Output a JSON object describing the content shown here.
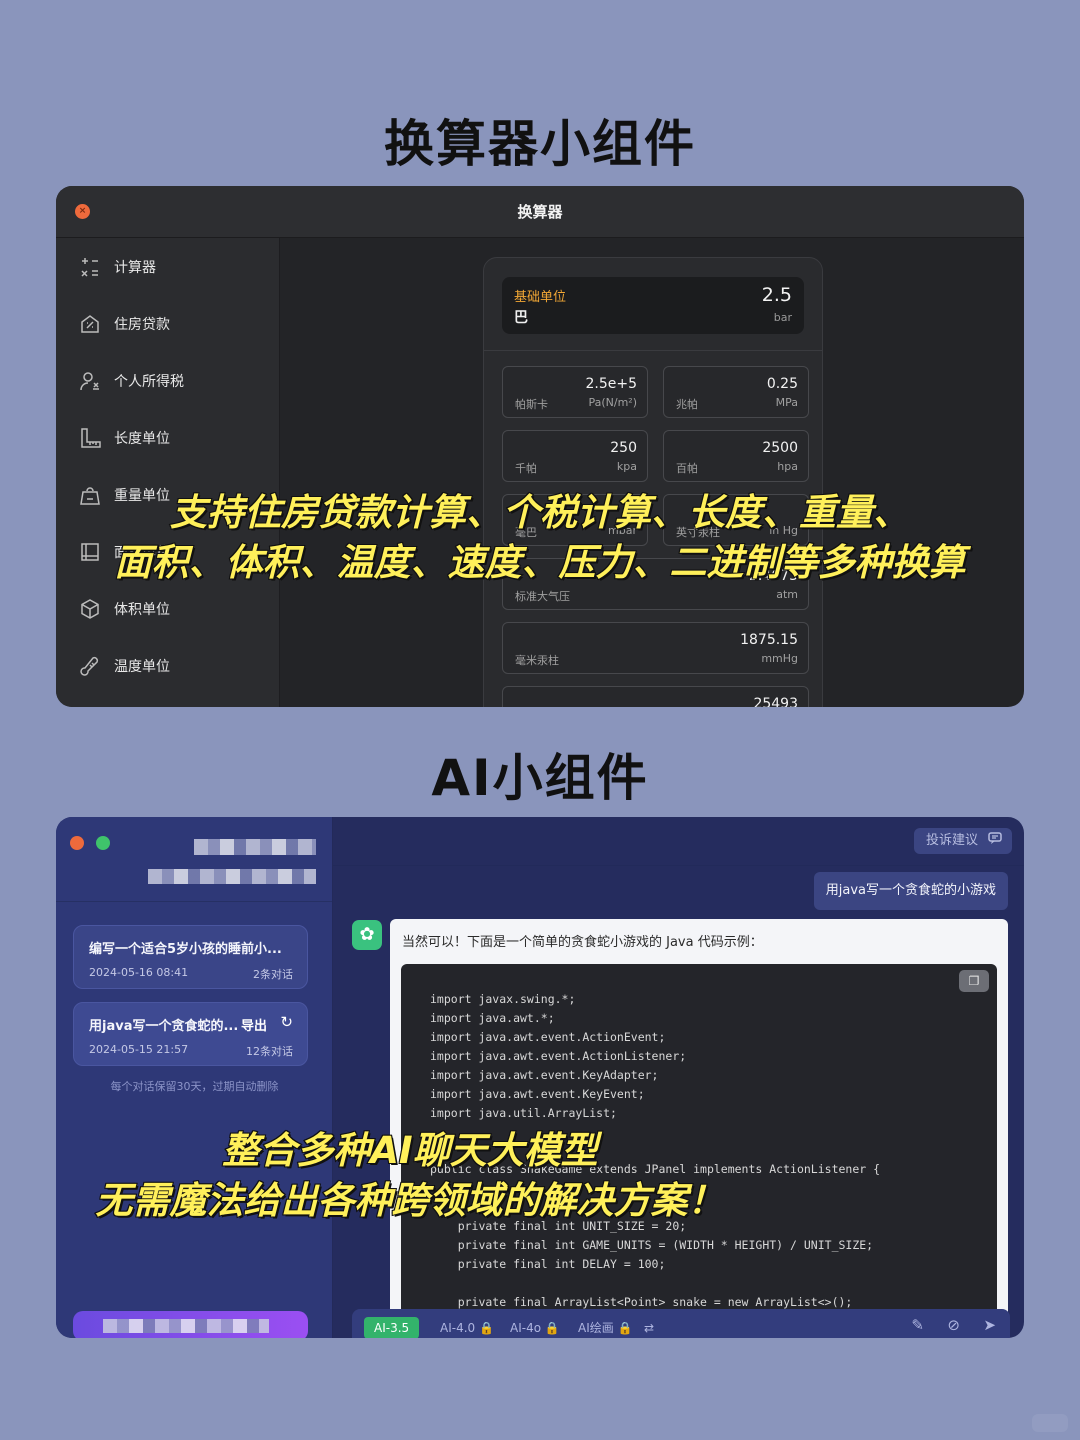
{
  "headings": {
    "top": "换算器小组件",
    "bottom": "AI小组件"
  },
  "converter": {
    "title": "换算器",
    "close_glyph": "×",
    "sidebar": [
      {
        "label": "计算器",
        "icon": "calculator-icon"
      },
      {
        "label": "住房贷款",
        "icon": "house-loan-icon"
      },
      {
        "label": "个人所得税",
        "icon": "person-tax-icon"
      },
      {
        "label": "长度单位",
        "icon": "ruler-icon"
      },
      {
        "label": "重量单位",
        "icon": "weight-icon"
      },
      {
        "label": "面积单位",
        "icon": "area-icon"
      },
      {
        "label": "体积单位",
        "icon": "cube-icon"
      },
      {
        "label": "温度单位",
        "icon": "thermometer-icon"
      }
    ],
    "base": {
      "label": "基础单位",
      "name": "巴",
      "value": "2.5",
      "unit": "bar"
    },
    "units": [
      {
        "value": "2.5e+5",
        "name": "帕斯卡",
        "unit": "Pa(N/m²)"
      },
      {
        "value": "0.25",
        "name": "兆帕",
        "unit": "MPa"
      },
      {
        "value": "250",
        "name": "千帕",
        "unit": "kpa"
      },
      {
        "value": "2500",
        "name": "百帕",
        "unit": "hpa"
      },
      {
        "value": "",
        "name": "毫巴",
        "unit": "mbar"
      },
      {
        "value": "",
        "name": "英寸汞柱",
        "unit": "in Hg"
      },
      {
        "value": "2.4673",
        "name": "标准大气压",
        "unit": "atm"
      },
      {
        "value": "1875.15",
        "name": "毫米汞柱",
        "unit": "mmHg"
      },
      {
        "value": "25493",
        "name": "",
        "unit": ""
      }
    ]
  },
  "overlay_top": {
    "line1": "支持住房贷款计算、个税计算、长度、重量、",
    "line2": "面积、体积、温度、速度、压力、二进制等多种换算"
  },
  "ai": {
    "feedback": "投诉建议",
    "conversations": [
      {
        "title": "编写一个适合5岁小孩的睡前小...",
        "date": "2024-05-16 08:41",
        "count": "2条对话"
      },
      {
        "title": "用java写一个贪食蛇的...",
        "date": "2024-05-15 21:57",
        "count": "12条对话",
        "export": "导出",
        "refresh": "↻"
      }
    ],
    "keep_note": "每个对话保留30天，过期自动删除",
    "user_message": "用java写一个贪食蛇的小游戏",
    "bot_intro": "当然可以！下面是一个简单的贪食蛇小游戏的 Java 代码示例：",
    "code_lines": [
      "import javax.swing.*;",
      "import java.awt.*;",
      "import java.awt.event.ActionEvent;",
      "import java.awt.event.ActionListener;",
      "import java.awt.event.KeyAdapter;",
      "import java.awt.event.KeyEvent;",
      "import java.util.ArrayList;",
      "public class SnakeGame extends JPanel implements ActionListener {",
      "    private final int UNIT_SIZE = 20;",
      "    private final int GAME_UNITS = (WIDTH * HEIGHT) / UNIT_SIZE;",
      "    private final int DELAY = 100;",
      "    private final ArrayList<Point> snake = new ArrayList<>();"
    ],
    "models": [
      "AI-3.5",
      "AI-4.0 🔒",
      "AI-4o 🔒",
      "AI绘画 🔒",
      "⇄"
    ]
  },
  "overlay_bottom": {
    "line1": "整合多种AI聊天大模型",
    "line2": "无需魔法给出各种跨领域的解决方案！"
  }
}
